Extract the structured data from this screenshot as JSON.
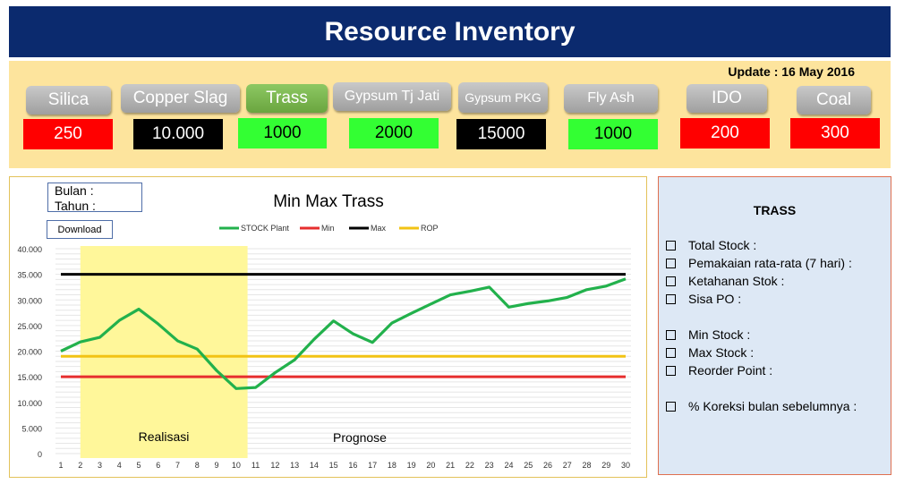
{
  "header": {
    "title": "Resource Inventory"
  },
  "resources": {
    "update_label": "Update : 16 May 2016",
    "items": [
      {
        "label": "Silica",
        "value": "250",
        "value_color": "#ff0000",
        "value_text_color": "#ffffff"
      },
      {
        "label": "Copper Slag",
        "value": "10.000",
        "value_color": "#000000",
        "value_text_color": "#ffffff"
      },
      {
        "label": "Trass",
        "value": "1000",
        "value_color": "#33ff33",
        "value_text_color": "#000000",
        "active": true
      },
      {
        "label": "Gypsum Tj Jati",
        "value": "2000",
        "value_color": "#33ff33",
        "value_text_color": "#000000"
      },
      {
        "label": "Gypsum PKG",
        "value": "15000",
        "value_color": "#000000",
        "value_text_color": "#ffffff"
      },
      {
        "label": "Fly Ash",
        "value": "1000",
        "value_color": "#33ff33",
        "value_text_color": "#000000"
      },
      {
        "label": "IDO",
        "value": "200",
        "value_color": "#ff0000",
        "value_text_color": "#ffffff"
      },
      {
        "label": "Coal",
        "value": "300",
        "value_color": "#ff0000",
        "value_text_color": "#ffffff"
      }
    ]
  },
  "chart_panel": {
    "bulan_label": "Bulan :",
    "tahun_label": "Tahun :",
    "download_label": "Download"
  },
  "chart_data": {
    "type": "line",
    "title": "Min Max Trass",
    "x": [
      1,
      2,
      3,
      4,
      5,
      6,
      7,
      8,
      9,
      10,
      11,
      12,
      13,
      14,
      15,
      16,
      17,
      18,
      19,
      20,
      21,
      22,
      23,
      24,
      25,
      26,
      27,
      28,
      29,
      30
    ],
    "ylim": [
      0,
      40000
    ],
    "yticks": [
      "0",
      "5.000",
      "10.000",
      "15.000",
      "20.000",
      "25.000",
      "30.000",
      "35.000",
      "40.000"
    ],
    "ytick_values": [
      0,
      5000,
      10000,
      15000,
      20000,
      25000,
      30000,
      35000,
      40000
    ],
    "series": [
      {
        "name": "STOCK Plant",
        "color": "#22b14c",
        "values": [
          20000,
          21800,
          22700,
          26000,
          28200,
          25300,
          22000,
          20400,
          16200,
          12700,
          12900,
          15800,
          18300,
          22300,
          25900,
          23400,
          21700,
          25500,
          27400,
          29200,
          31000,
          31700,
          32500,
          28600,
          29300,
          29800,
          30500,
          32000,
          32700,
          34100
        ]
      },
      {
        "name": "Min",
        "color": "#e62e2e",
        "values": [
          15000,
          15000,
          15000,
          15000,
          15000,
          15000,
          15000,
          15000,
          15000,
          15000,
          15000,
          15000,
          15000,
          15000,
          15000,
          15000,
          15000,
          15000,
          15000,
          15000,
          15000,
          15000,
          15000,
          15000,
          15000,
          15000,
          15000,
          15000,
          15000,
          15000
        ]
      },
      {
        "name": "Max",
        "color": "#000000",
        "values": [
          35000,
          35000,
          35000,
          35000,
          35000,
          35000,
          35000,
          35000,
          35000,
          35000,
          35000,
          35000,
          35000,
          35000,
          35000,
          35000,
          35000,
          35000,
          35000,
          35000,
          35000,
          35000,
          35000,
          35000,
          35000,
          35000,
          35000,
          35000,
          35000,
          35000
        ]
      },
      {
        "name": "ROP",
        "color": "#f2c314",
        "values": [
          19000,
          19000,
          19000,
          19000,
          19000,
          19000,
          19000,
          19000,
          19000,
          19000,
          19000,
          19000,
          19000,
          19000,
          19000,
          19000,
          19000,
          19000,
          19000,
          19000,
          19000,
          19000,
          19000,
          19000,
          19000,
          19000,
          19000,
          19000,
          19000,
          19000
        ]
      }
    ],
    "highlight": {
      "from": 2,
      "to": 11,
      "color": "#fff79a"
    },
    "annotations": {
      "realisasi": "Realisasi",
      "prognose": "Prognose"
    },
    "legend_position": "top",
    "grid": true
  },
  "info": {
    "title": "TRASS",
    "items": [
      "Total Stock :",
      "Pemakaian rata-rata (7 hari) :",
      "Ketahanan Stok :",
      "Sisa PO :",
      "Min Stock :",
      "Max Stock :",
      "Reorder Point :",
      "% Koreksi bulan sebelumnya :"
    ]
  }
}
